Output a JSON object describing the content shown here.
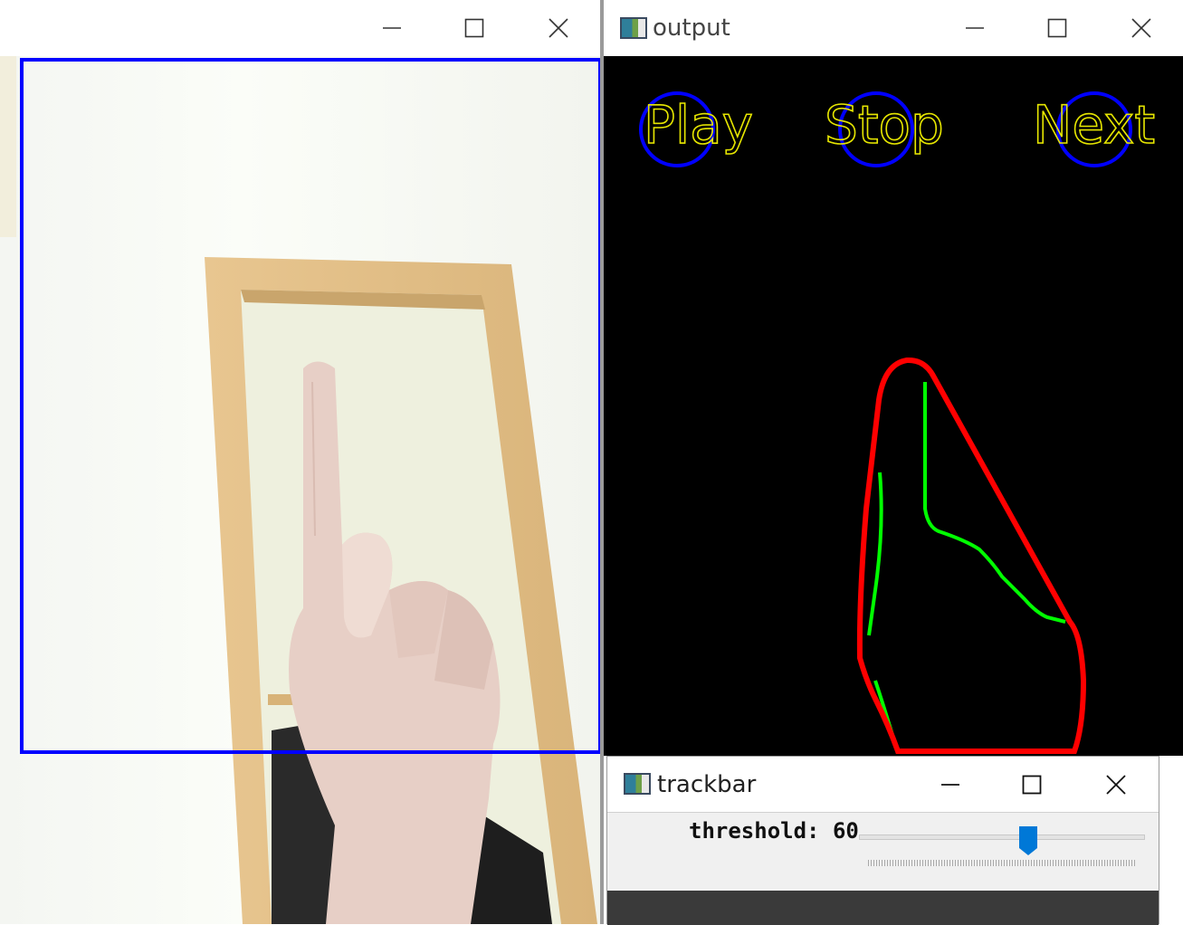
{
  "camera_window": {
    "title": "",
    "controls": {
      "minimize": "minimize-icon",
      "maximize": "maximize-icon",
      "close": "close-icon"
    }
  },
  "output_window": {
    "title": "output",
    "buttons": [
      {
        "label": "Play"
      },
      {
        "label": "Stop"
      },
      {
        "label": "Next"
      }
    ],
    "colors": {
      "button_text": "#e6e600",
      "button_circle": "#0000ff",
      "hull": "#ff0000",
      "contour": "#00ff00",
      "background": "#000000"
    }
  },
  "trackbar_window": {
    "title": "trackbar",
    "label": "threshold: 60",
    "value": 60,
    "max": 100
  }
}
